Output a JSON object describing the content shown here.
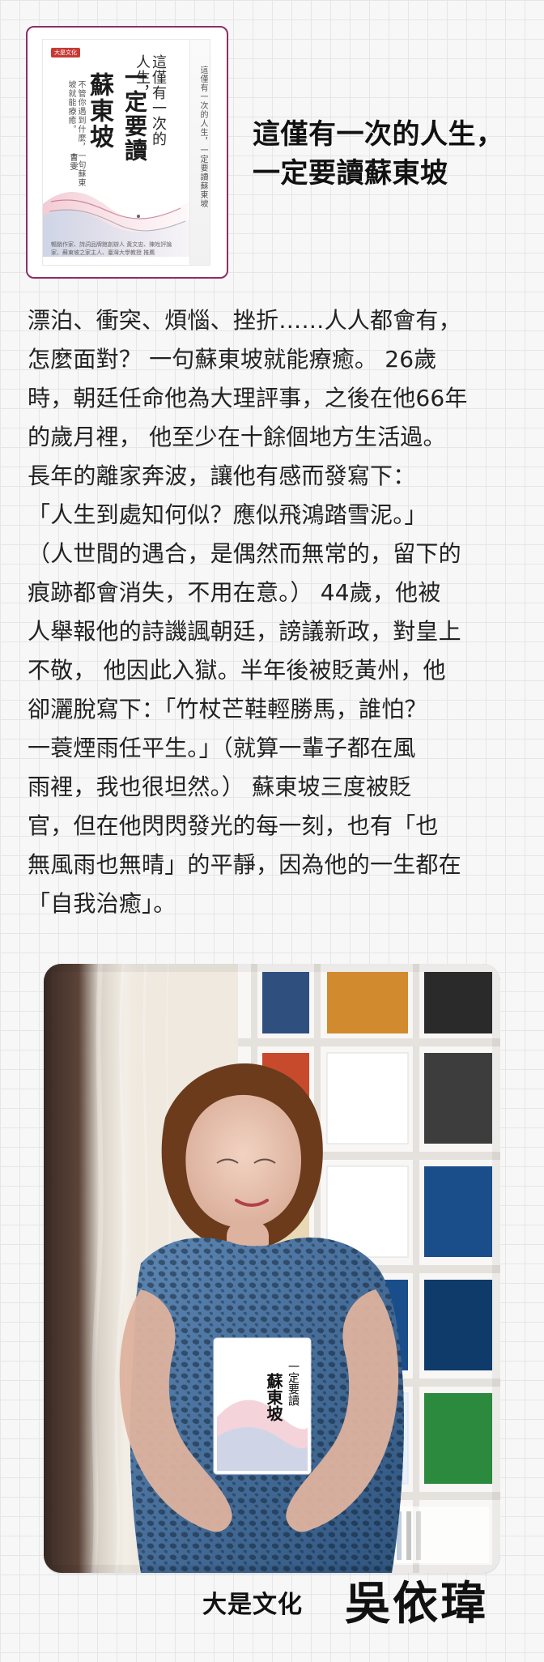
{
  "theme": {
    "accent": "#8e2f63",
    "text": "#222222",
    "grid_bg": "#f7f7f7",
    "grid_line": "#e6e6e6",
    "cover_badge": "#c73a34"
  },
  "cover": {
    "badge": "大是文化",
    "spine_text": "這僅有一次的人生，一定要讀蘇東坡",
    "subtitle": "這僅有一次的人生，",
    "title_main": "一定要讀",
    "title_name": "蘇東坡",
    "slogan": "不管你遇到什麼，一句蘇東坡就能療癒。",
    "author": "曹雯",
    "endorsements": "暢銷作家、詩詞品牌館創辦人 黃文忠、陳姓評論家、蘇東坡之家主人、臺灣大學教授 推薦"
  },
  "headline": "這僅有一次的人生，\n一定要讀蘇東坡",
  "body_text": "漂泊、衝突、煩惱、挫折……人人都會有，\n怎麼面對？ 一句蘇東坡就能療癒。 26歲\n時，朝廷任命他為大理評事，之後在他66年\n的歲月裡， 他至少在十餘個地方生活過。\n長年的離家奔波，讓他有感而發寫下：\n「人生到處知何似？應似飛鴻踏雪泥。」\n（人世間的遇合，是偶然而無常的，留下的\n痕跡都會消失，不用在意。） 44歲，他被\n人舉報他的詩譏諷朝廷，謗議新政，對皇上\n不敬， 他因此入獄。半年後被貶黃州，他\n卻灑脫寫下：「竹杖芒鞋輕勝馬，誰怕？\n一蓑煙雨任平生。」（就算一輩子都在風\n雨裡，我也很坦然。） 蘇東坡三度被貶\n官，但在他閃閃發光的每一刻，也有「也\n無風雨也無晴」的平靜，因為他的一生都在\n「自我治癒」。",
  "photo": {
    "icon": "portrait-photo"
  },
  "footer": {
    "publisher": "大是文化",
    "person": "吳依瑋"
  }
}
